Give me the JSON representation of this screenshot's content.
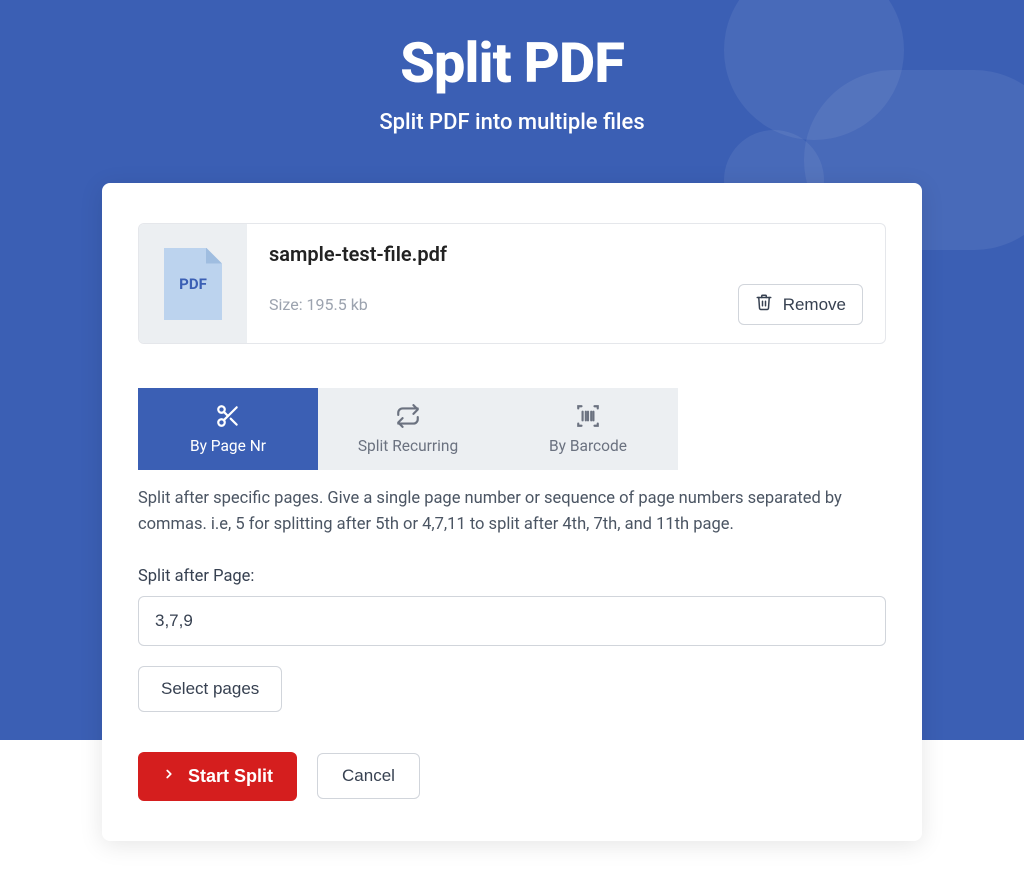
{
  "header": {
    "title": "Split PDF",
    "subtitle": "Split PDF into multiple files"
  },
  "file": {
    "badge": "PDF",
    "name": "sample-test-file.pdf",
    "size_label": "Size: 195.5 kb",
    "remove_label": "Remove"
  },
  "tabs": {
    "by_page_nr": {
      "label": "By Page Nr",
      "active": true
    },
    "split_recurring": {
      "label": "Split Recurring",
      "active": false
    },
    "by_barcode": {
      "label": "By Barcode",
      "active": false
    }
  },
  "panel": {
    "help_text": "Split after specific pages. Give a single page number or sequence of page numbers separated by commas. i.e, 5 for splitting after 5th or 4,7,11 to split after 4th, 7th, and 11th page.",
    "field_label": "Split after Page:",
    "input_value": "3,7,9",
    "select_pages_label": "Select pages"
  },
  "actions": {
    "start_label": "Start Split",
    "cancel_label": "Cancel"
  },
  "colors": {
    "primary": "#3b5fb4",
    "danger": "#d51e1e"
  }
}
